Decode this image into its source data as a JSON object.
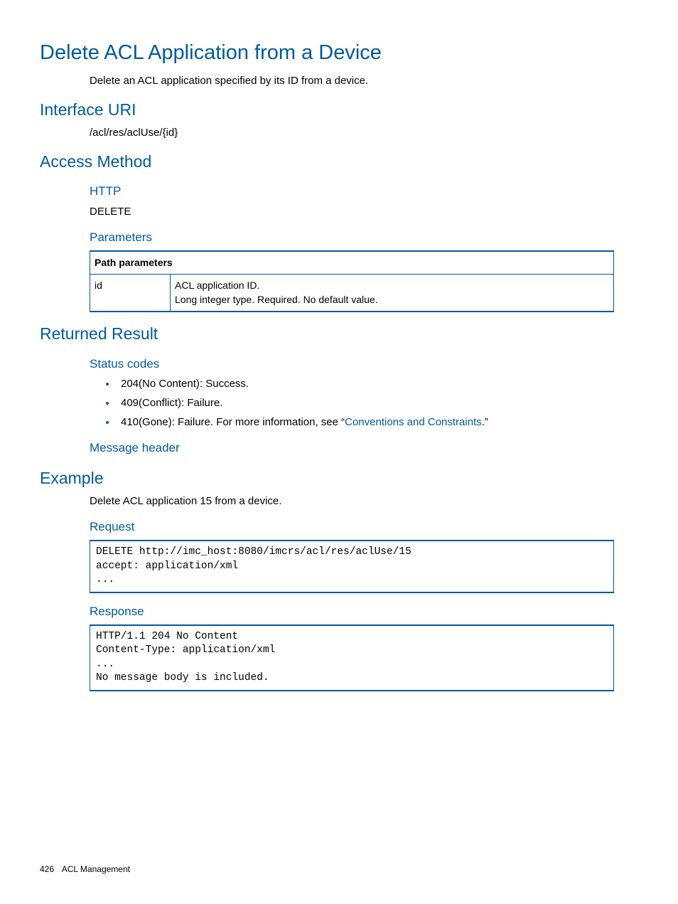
{
  "title": "Delete ACL Application from a Device",
  "intro": "Delete an ACL application specified by its ID from a device.",
  "sections": {
    "interface_uri": {
      "heading": "Interface URI",
      "value": "/acl/res/aclUse/{id}"
    },
    "access_method": {
      "heading": "Access Method",
      "http_heading": "HTTP",
      "http_value": "DELETE",
      "parameters_heading": "Parameters",
      "table": {
        "header": "Path parameters",
        "param_name": "id",
        "param_desc_line1": "ACL application ID.",
        "param_desc_line2": "Long integer type. Required. No default value."
      }
    },
    "returned_result": {
      "heading": "Returned Result",
      "status_codes_heading": "Status codes",
      "status_204": "204(No Content): Success.",
      "status_409": "409(Conflict): Failure.",
      "status_410_prefix": "410(Gone): Failure. For more information, see “",
      "status_410_link": "Conventions and Constraints",
      "status_410_suffix": ".”",
      "message_header_heading": "Message header"
    },
    "example": {
      "heading": "Example",
      "intro": "Delete ACL application 15 from a device.",
      "request_heading": "Request",
      "request_code": "DELETE http://imc_host:8080/imcrs/acl/res/aclUse/15\naccept: application/xml\n...",
      "response_heading": "Response",
      "response_code": "HTTP/1.1 204 No Content\nContent-Type: application/xml\n...\nNo message body is included."
    }
  },
  "footer": {
    "page_number": "426",
    "section": "ACL Management"
  }
}
